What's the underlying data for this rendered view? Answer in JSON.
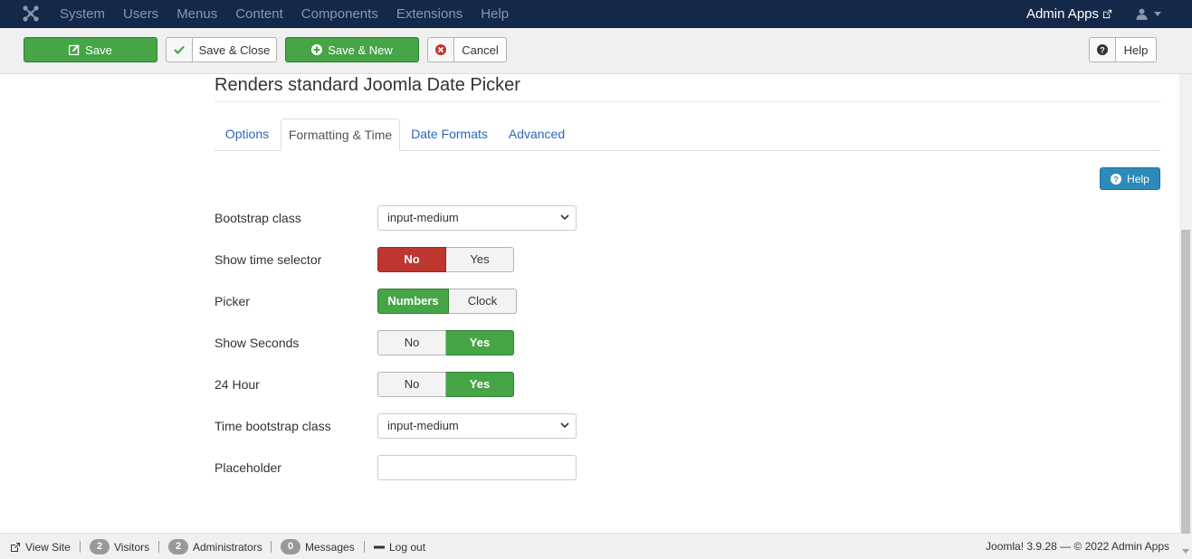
{
  "navbar": {
    "menu": [
      "System",
      "Users",
      "Menus",
      "Content",
      "Components",
      "Extensions",
      "Help"
    ],
    "site_name": "Admin Apps"
  },
  "toolbar": {
    "save": "Save",
    "save_close": "Save & Close",
    "save_new": "Save & New",
    "cancel": "Cancel",
    "help": "Help"
  },
  "page": {
    "title": "Renders standard Joomla Date Picker",
    "tabs": [
      "Options",
      "Formatting & Time",
      "Date Formats",
      "Advanced"
    ],
    "active_tab": "Formatting & Time",
    "help_button": "Help"
  },
  "form": {
    "bootstrap_class": {
      "label": "Bootstrap class",
      "value": "input-medium"
    },
    "show_time_selector": {
      "label": "Show time selector",
      "options": [
        "No",
        "Yes"
      ],
      "selected": "No"
    },
    "picker": {
      "label": "Picker",
      "options": [
        "Numbers",
        "Clock"
      ],
      "selected": "Numbers"
    },
    "show_seconds": {
      "label": "Show Seconds",
      "options": [
        "No",
        "Yes"
      ],
      "selected": "Yes"
    },
    "hour24": {
      "label": "24 Hour",
      "options": [
        "No",
        "Yes"
      ],
      "selected": "Yes"
    },
    "time_bootstrap_class": {
      "label": "Time bootstrap class",
      "value": "input-medium"
    },
    "placeholder": {
      "label": "Placeholder",
      "value": ""
    }
  },
  "statusbar": {
    "view_site": "View Site",
    "visitors_count": "2",
    "visitors": "Visitors",
    "admins_count": "2",
    "admins": "Administrators",
    "messages_count": "0",
    "messages": "Messages",
    "logout": "Log out",
    "footer": "Joomla! 3.9.28 — © 2022 Admin Apps"
  },
  "colors": {
    "navbar_bg": "#142849",
    "success": "#46a546",
    "danger": "#bd362f",
    "link": "#2a69b8",
    "info": "#2e8ab8"
  },
  "icons": [
    "joomla-logo-icon",
    "external-link-icon",
    "user-icon",
    "edit-icon",
    "check-icon",
    "plus-circle-icon",
    "cancel-icon",
    "question-icon",
    "chevron-down-icon",
    "minus-icon"
  ]
}
